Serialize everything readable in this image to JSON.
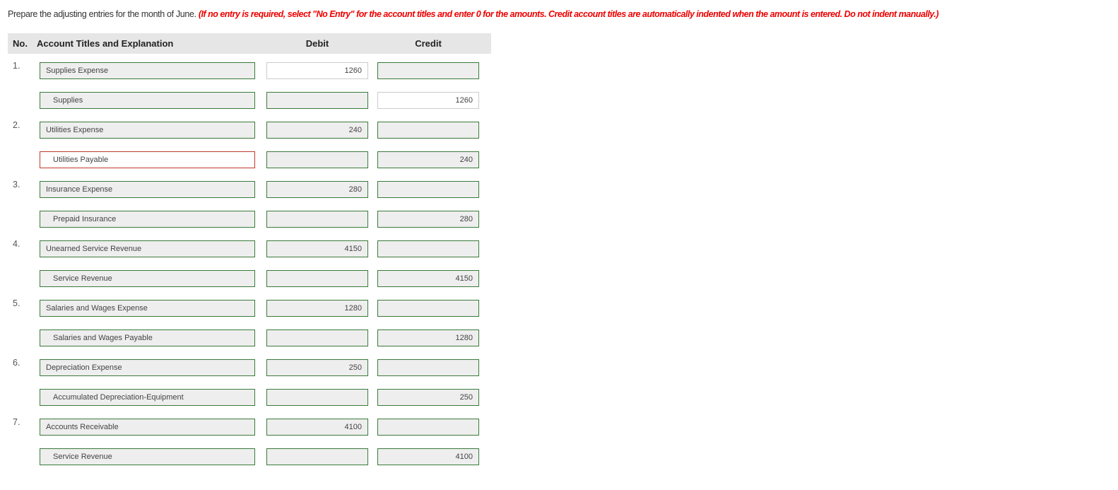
{
  "instructions": {
    "text": "Prepare the adjusting entries for the month of June.",
    "note": "(If no entry is required, select \"No Entry\" for the account titles and enter 0 for the amounts. Credit account titles are automatically indented when the amount is entered. Do not indent manually.)"
  },
  "table": {
    "headers": {
      "no": "No.",
      "account": "Account Titles and Explanation",
      "debit": "Debit",
      "credit": "Credit"
    },
    "rows": [
      {
        "no": "1.",
        "account": "Supplies Expense",
        "debit": "1260",
        "credit": "",
        "indent": false,
        "account_state": "correct",
        "debit_state": "plain",
        "credit_state": "correct"
      },
      {
        "no": "",
        "account": "Supplies",
        "debit": "",
        "credit": "1260",
        "indent": true,
        "account_state": "correct",
        "debit_state": "correct",
        "credit_state": "plain"
      },
      {
        "no": "2.",
        "account": "Utilities Expense",
        "debit": "240",
        "credit": "",
        "indent": false,
        "account_state": "correct",
        "debit_state": "correct",
        "credit_state": "correct"
      },
      {
        "no": "",
        "account": "Utilities Payable",
        "debit": "",
        "credit": "240",
        "indent": true,
        "account_state": "error",
        "debit_state": "correct",
        "credit_state": "correct"
      },
      {
        "no": "3.",
        "account": "Insurance Expense",
        "debit": "280",
        "credit": "",
        "indent": false,
        "account_state": "correct",
        "debit_state": "correct",
        "credit_state": "correct"
      },
      {
        "no": "",
        "account": "Prepaid Insurance",
        "debit": "",
        "credit": "280",
        "indent": true,
        "account_state": "correct",
        "debit_state": "correct",
        "credit_state": "correct"
      },
      {
        "no": "4.",
        "account": "Unearned Service Revenue",
        "debit": "4150",
        "credit": "",
        "indent": false,
        "account_state": "correct",
        "debit_state": "correct",
        "credit_state": "correct"
      },
      {
        "no": "",
        "account": "Service Revenue",
        "debit": "",
        "credit": "4150",
        "indent": true,
        "account_state": "correct",
        "debit_state": "correct",
        "credit_state": "correct"
      },
      {
        "no": "5.",
        "account": "Salaries and Wages Expense",
        "debit": "1280",
        "credit": "",
        "indent": false,
        "account_state": "correct",
        "debit_state": "correct",
        "credit_state": "correct"
      },
      {
        "no": "",
        "account": "Salaries and Wages Payable",
        "debit": "",
        "credit": "1280",
        "indent": true,
        "account_state": "correct",
        "debit_state": "correct",
        "credit_state": "correct"
      },
      {
        "no": "6.",
        "account": "Depreciation Expense",
        "debit": "250",
        "credit": "",
        "indent": false,
        "account_state": "correct",
        "debit_state": "correct",
        "credit_state": "correct"
      },
      {
        "no": "",
        "account": "Accumulated Depreciation-Equipment",
        "debit": "",
        "credit": "250",
        "indent": true,
        "account_state": "correct",
        "debit_state": "correct",
        "credit_state": "correct"
      },
      {
        "no": "7.",
        "account": "Accounts Receivable",
        "debit": "4100",
        "credit": "",
        "indent": false,
        "account_state": "correct",
        "debit_state": "correct",
        "credit_state": "correct"
      },
      {
        "no": "",
        "account": "Service Revenue",
        "debit": "",
        "credit": "4100",
        "indent": true,
        "account_state": "correct",
        "debit_state": "correct",
        "credit_state": "correct"
      }
    ]
  },
  "colors": {
    "correct_border": "#3a7a3a",
    "error_border": "#c0392b",
    "note_text": "#ee0000",
    "header_bg": "#e6e6e6",
    "field_bg": "#eeeeee"
  }
}
